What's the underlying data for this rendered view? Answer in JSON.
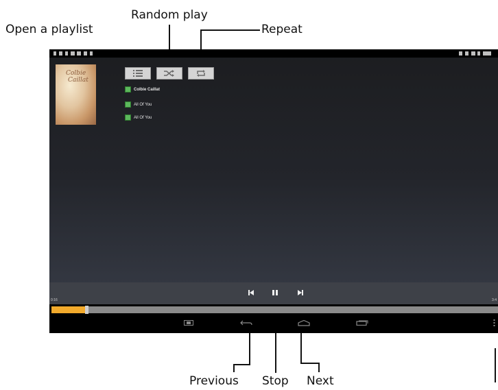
{
  "callouts": {
    "open_playlist": "Open a playlist",
    "random_play": "Random play",
    "repeat": "Repeat",
    "previous": "Previous",
    "stop": "Stop",
    "next": "Next"
  },
  "album": {
    "line1": "Colbie",
    "line2": "Caillat"
  },
  "tracks": [
    {
      "label": "Colbie Caillat"
    },
    {
      "label": "All Of You"
    },
    {
      "label": "All Of You"
    }
  ],
  "player": {
    "elapsed": "0:16",
    "remaining": "3:4",
    "progress_fraction": 0.075
  },
  "colors": {
    "progress": "#f2aa2c",
    "track_icon": "#5cb85c"
  },
  "icons": {
    "playlist": "list-icon",
    "shuffle": "shuffle-icon",
    "repeat": "repeat-icon",
    "previous": "skip-previous-icon",
    "stop": "pause-icon",
    "next": "skip-next-icon",
    "screenshot": "screenshot-icon",
    "back": "back-icon",
    "home": "home-icon",
    "recents": "recent-apps-icon",
    "menu": "overflow-menu-icon"
  }
}
